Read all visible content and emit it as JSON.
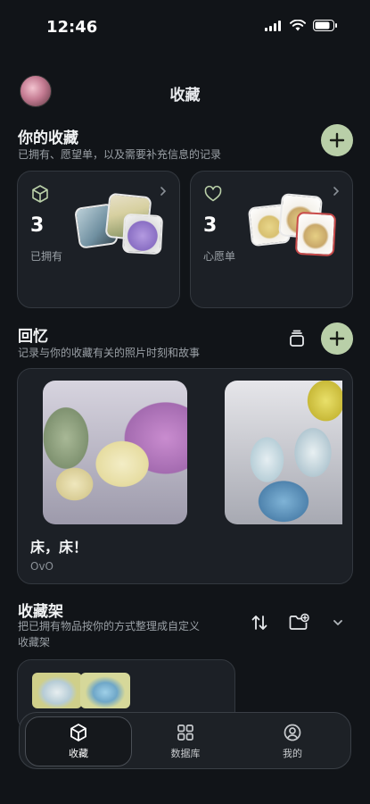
{
  "status": {
    "time": "12:46"
  },
  "header": {
    "title": "收藏"
  },
  "collection": {
    "title": "你的收藏",
    "subtitle": "已拥有、愿望单，以及需要补充信息的记录",
    "owned": {
      "count": "3",
      "label": "已拥有"
    },
    "wishlist": {
      "count": "3",
      "label": "心愿单"
    }
  },
  "memories": {
    "title": "回忆",
    "subtitle": "记录与你的收藏有关的照片时刻和故事",
    "items": [
      {
        "caption": "床，床！",
        "author": "OvO"
      }
    ]
  },
  "shelf": {
    "title": "收藏架",
    "subtitle_line1": "把已拥有物品按你的方式整理成自定义",
    "subtitle_line2": "收藏架"
  },
  "nav": {
    "items": [
      {
        "label": "收藏",
        "icon": "cube-icon",
        "active": true
      },
      {
        "label": "数据库",
        "icon": "grid-icon",
        "active": false
      },
      {
        "label": "我的",
        "icon": "profile-icon",
        "active": false
      }
    ]
  },
  "colors": {
    "background": "#111418",
    "accent": "#b9cfa8",
    "card": "#1c2026"
  }
}
